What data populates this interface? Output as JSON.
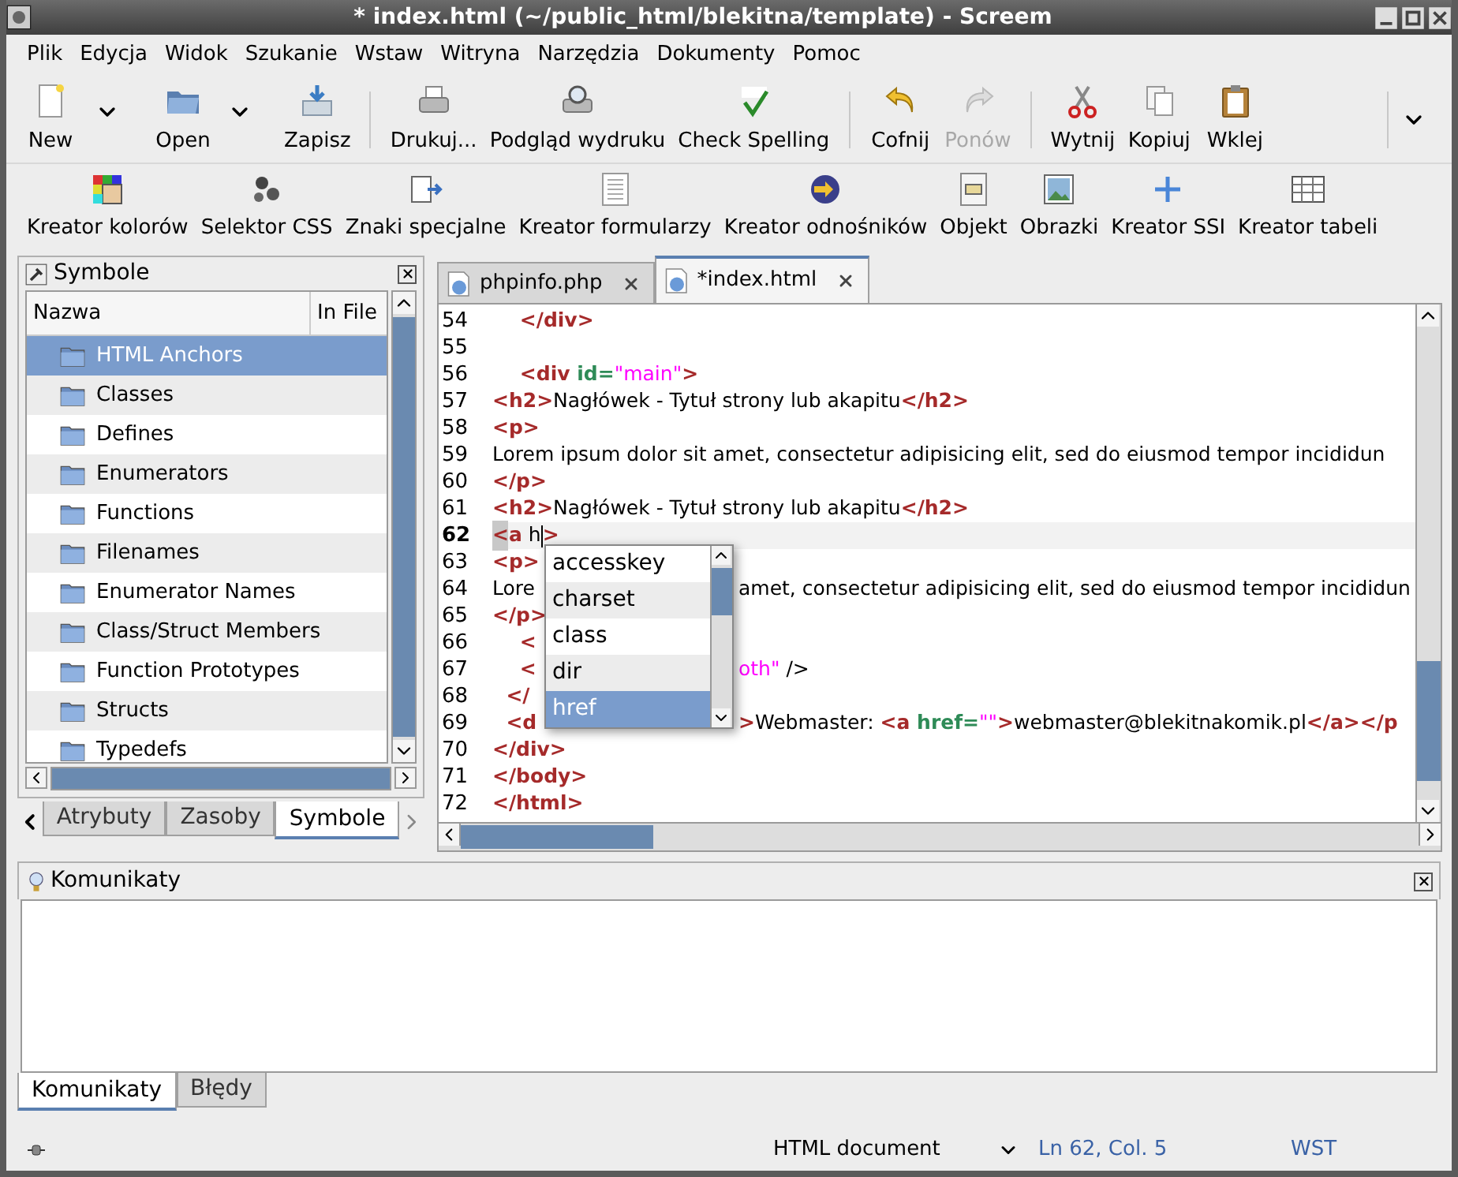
{
  "window": {
    "title": "* index.html (~/public_html/blekitna/template) - Screem"
  },
  "menu": [
    "Plik",
    "Edycja",
    "Widok",
    "Szukanie",
    "Wstaw",
    "Witryna",
    "Narzędzia",
    "Dokumenty",
    "Pomoc"
  ],
  "toolbar": {
    "groups": [
      [
        {
          "label": "New",
          "dropdown": true,
          "disabled": false
        },
        {
          "label": "Open",
          "dropdown": true,
          "disabled": false
        },
        {
          "label": "Zapisz",
          "dropdown": false,
          "disabled": false
        }
      ],
      [
        {
          "label": "Drukuj...",
          "dropdown": false,
          "disabled": false
        },
        {
          "label": "Podgląd wydruku",
          "dropdown": false,
          "disabled": false
        },
        {
          "label": "Check Spelling",
          "dropdown": false,
          "disabled": false
        }
      ],
      [
        {
          "label": "Cofnij",
          "dropdown": false,
          "disabled": false
        },
        {
          "label": "Ponów",
          "dropdown": false,
          "disabled": true
        }
      ],
      [
        {
          "label": "Wytnij",
          "dropdown": false,
          "disabled": false
        },
        {
          "label": "Kopiuj",
          "dropdown": false,
          "disabled": false
        },
        {
          "label": "Wklej",
          "dropdown": false,
          "disabled": false
        }
      ]
    ]
  },
  "wizards": [
    "Kreator kolorów",
    "Selektor CSS",
    "Znaki specjalne",
    "Kreator formularzy",
    "Kreator odnośników",
    "Objekt",
    "Obrazki",
    "Kreator SSI",
    "Kreator tabeli"
  ],
  "sidebar": {
    "title": "Symbole",
    "columns": [
      "Nazwa",
      "In File"
    ],
    "rows": [
      {
        "name": "HTML Anchors",
        "selected": true
      },
      {
        "name": "Classes",
        "selected": false
      },
      {
        "name": "Defines",
        "selected": false
      },
      {
        "name": "Enumerators",
        "selected": false
      },
      {
        "name": "Functions",
        "selected": false
      },
      {
        "name": "Filenames",
        "selected": false
      },
      {
        "name": "Enumerator Names",
        "selected": false
      },
      {
        "name": "Class/Struct Members",
        "selected": false
      },
      {
        "name": "Function Prototypes",
        "selected": false
      },
      {
        "name": "Structs",
        "selected": false
      },
      {
        "name": "Typedefs",
        "selected": false
      }
    ],
    "tabs": [
      {
        "label": "Atrybuty",
        "selected": false
      },
      {
        "label": "Zasoby",
        "selected": false
      },
      {
        "label": "Symbole",
        "selected": true
      }
    ]
  },
  "editor": {
    "tabs": [
      {
        "label": "phpinfo.php",
        "selected": false
      },
      {
        "label": "*index.html",
        "selected": true
      }
    ],
    "lines": [
      {
        "num": "54",
        "current": false,
        "segments": [
          {
            "kind": "tag",
            "text": "    </div>"
          }
        ]
      },
      {
        "num": "55",
        "current": false
      },
      {
        "num": "56",
        "current": false,
        "segments": [
          {
            "kind": "tag",
            "text": "    <div "
          },
          {
            "kind": "attr",
            "text": "id="
          },
          {
            "kind": "string",
            "text": "\"main\""
          },
          {
            "kind": "tag",
            "text": ">"
          }
        ]
      },
      {
        "num": "57",
        "current": false,
        "segments": [
          {
            "kind": "tag",
            "text": "<h2>"
          },
          {
            "kind": "text",
            "text": "Nagłówek - Tytuł strony lub akapitu"
          },
          {
            "kind": "tag",
            "text": "</h2>"
          }
        ]
      },
      {
        "num": "58",
        "current": false,
        "segments": [
          {
            "kind": "tag",
            "text": "<p>"
          }
        ]
      },
      {
        "num": "59",
        "current": false,
        "segments": [
          {
            "kind": "text",
            "text": "Lorem ipsum dolor sit amet, consectetur adipisicing elit, sed do eiusmod tempor incididun"
          }
        ]
      },
      {
        "num": "60",
        "current": false,
        "segments": [
          {
            "kind": "tag",
            "text": "</p>"
          }
        ]
      },
      {
        "num": "61",
        "current": false,
        "segments": [
          {
            "kind": "tag",
            "text": "<h2>"
          },
          {
            "kind": "text",
            "text": "Nagłówek - Tytuł strony lub akapitu"
          },
          {
            "kind": "tag",
            "text": "</h2>"
          }
        ]
      },
      {
        "num": "62",
        "current": true,
        "segments": [
          {
            "kind": "match",
            "text": "<"
          },
          {
            "kind": "tag",
            "text": "a"
          },
          {
            "kind": "text",
            "text": " h"
          },
          {
            "kind": "cursor"
          },
          {
            "kind": "tag",
            "text": ">"
          }
        ]
      },
      {
        "num": "63",
        "current": false,
        "segments": [
          {
            "kind": "tag",
            "text": "<p>"
          }
        ]
      },
      {
        "num": "64",
        "current": false,
        "segments": [
          {
            "kind": "text",
            "text": "Lore"
          }
        ],
        "after_popup": [
          {
            "kind": "text",
            "text": "amet, consectetur adipisicing elit, sed do eiusmod tempor incididun"
          }
        ]
      },
      {
        "num": "65",
        "current": false,
        "segments": [
          {
            "kind": "tag",
            "text": "</p>"
          }
        ]
      },
      {
        "num": "66",
        "current": false,
        "segments": [
          {
            "kind": "tag",
            "text": "    <"
          }
        ]
      },
      {
        "num": "67",
        "current": false,
        "segments": [
          {
            "kind": "tag",
            "text": "    <"
          }
        ],
        "after_popup": [
          {
            "kind": "string",
            "text": "oth\""
          },
          {
            "kind": "text",
            "text": " />"
          }
        ]
      },
      {
        "num": "68",
        "current": false,
        "segments": [
          {
            "kind": "tag",
            "text": "  </"
          }
        ]
      },
      {
        "num": "69",
        "current": false,
        "segments": [
          {
            "kind": "tag",
            "text": "  <d"
          }
        ],
        "after_popup": [
          {
            "kind": "tag",
            "text": ">"
          },
          {
            "kind": "text",
            "text": "Webmaster: "
          },
          {
            "kind": "tag",
            "text": "<a "
          },
          {
            "kind": "attr",
            "text": "href="
          },
          {
            "kind": "string",
            "text": "\"\""
          },
          {
            "kind": "tag",
            "text": ">"
          },
          {
            "kind": "text",
            "text": "webmaster@blekitnakomik.pl"
          },
          {
            "kind": "tag",
            "text": "</a></p"
          }
        ]
      },
      {
        "num": "70",
        "current": false,
        "segments": [
          {
            "kind": "tag",
            "text": "</div>"
          }
        ]
      },
      {
        "num": "71",
        "current": false,
        "segments": [
          {
            "kind": "tag",
            "text": "</body>"
          }
        ]
      },
      {
        "num": "72",
        "current": false,
        "segments": [
          {
            "kind": "tag",
            "text": "</html>"
          }
        ]
      }
    ],
    "completion": [
      {
        "label": "accesskey",
        "selected": false
      },
      {
        "label": "charset",
        "selected": false
      },
      {
        "label": "class",
        "selected": false
      },
      {
        "label": "dir",
        "selected": false
      },
      {
        "label": "href",
        "selected": true
      }
    ]
  },
  "messages": {
    "title": "Komunikaty",
    "tabs": [
      {
        "label": "Komunikaty",
        "selected": true
      },
      {
        "label": "Błędy",
        "selected": false
      }
    ]
  },
  "status_bar": {
    "doc_type": "HTML document",
    "position": "Ln 62, Col. 5",
    "mode": "WST"
  }
}
